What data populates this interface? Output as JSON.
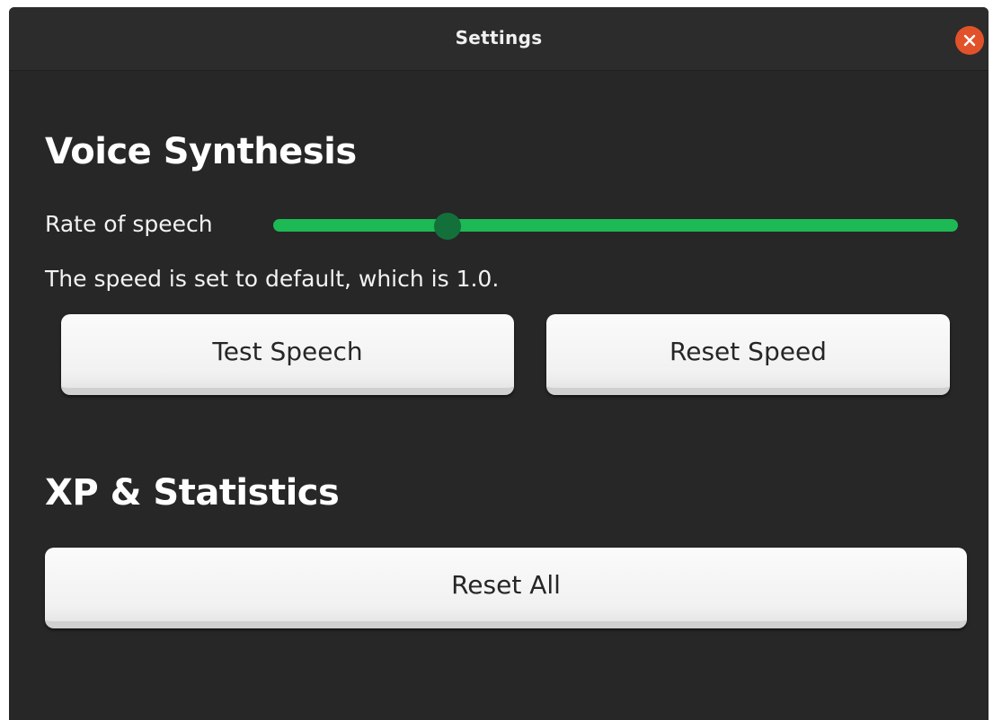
{
  "window": {
    "title": "Settings",
    "close_icon": "close-icon"
  },
  "colors": {
    "background": "#272727",
    "accent": "#1db954",
    "slider_thumb": "#14703b",
    "close": "#e2522a"
  },
  "voice_synthesis": {
    "heading": "Voice Synthesis",
    "rate_label": "Rate of speech",
    "rate_fraction": 0.255,
    "speed_text": "The speed is set to default, which is 1.0.",
    "test_button": "Test Speech",
    "reset_speed_button": "Reset Speed"
  },
  "xp_statistics": {
    "heading": "XP & Statistics",
    "reset_all_button": "Reset All"
  }
}
